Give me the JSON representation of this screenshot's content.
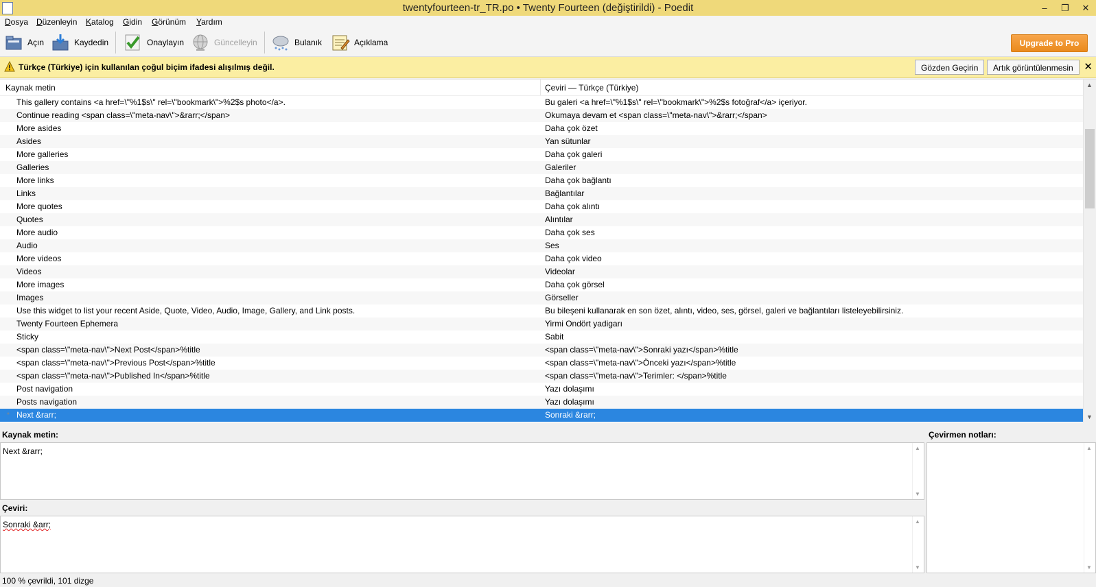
{
  "window": {
    "title": "twentyfourteen-tr_TR.po • Twenty Fourteen (değiştirildi)  - Poedit"
  },
  "menu": [
    "Dosya",
    "Düzenleyin",
    "Katalog",
    "Gidin",
    "Görünüm",
    "Yardım"
  ],
  "toolbar": {
    "open": "Açın",
    "save": "Kaydedin",
    "validate": "Onaylayın",
    "update": "Güncelleyin",
    "fuzzy": "Bulanık",
    "comment": "Açıklama",
    "upgrade": "Upgrade to Pro"
  },
  "warning": {
    "message": "Türkçe (Türkiye) için kullanılan çoğul biçim ifadesi alışılmış değil.",
    "review_button": "Gözden Geçirin",
    "dismiss_button": "Artık görüntülenmesin",
    "close": "✕"
  },
  "list": {
    "col_source": "Kaynak metin",
    "col_translation": "Çeviri — Türkçe (Türkiye)",
    "rows": [
      {
        "src": "This gallery contains <a href=\\\"%1$s\\\" rel=\\\"bookmark\\\">%2$s photo</a>.",
        "trn": "Bu galeri <a href=\\\"%1$s\\\" rel=\\\"bookmark\\\">%2$s fotoğraf</a> içeriyor."
      },
      {
        "src": "Continue reading <span class=\\\"meta-nav\\\">&rarr;</span>",
        "trn": "Okumaya devam et <span class=\\\"meta-nav\\\">&rarr;</span>"
      },
      {
        "src": "More asides",
        "trn": "Daha çok özet"
      },
      {
        "src": "Asides",
        "trn": "Yan sütunlar"
      },
      {
        "src": "More galleries",
        "trn": "Daha çok galeri"
      },
      {
        "src": "Galleries",
        "trn": "Galeriler"
      },
      {
        "src": "More links",
        "trn": "Daha çok bağlantı"
      },
      {
        "src": "Links",
        "trn": "Bağlantılar"
      },
      {
        "src": "More quotes",
        "trn": "Daha çok alıntı"
      },
      {
        "src": "Quotes",
        "trn": "Alıntılar"
      },
      {
        "src": "More audio",
        "trn": "Daha çok ses"
      },
      {
        "src": "Audio",
        "trn": "Ses"
      },
      {
        "src": "More videos",
        "trn": "Daha çok video"
      },
      {
        "src": "Videos",
        "trn": "Videolar"
      },
      {
        "src": "More images",
        "trn": "Daha çok görsel"
      },
      {
        "src": "Images",
        "trn": "Görseller"
      },
      {
        "src": "Use this widget to list your recent Aside, Quote, Video, Audio, Image, Gallery, and Link posts.",
        "trn": "Bu bileşeni kullanarak en son özet, alıntı, video, ses, görsel, galeri ve bağlantıları listeleyebilirsiniz."
      },
      {
        "src": "Twenty Fourteen Ephemera",
        "trn": "Yirmi Ondört yadigarı"
      },
      {
        "src": "Sticky",
        "trn": "Sabit"
      },
      {
        "src": "<span class=\\\"meta-nav\\\">Next Post</span>%title",
        "trn": "<span class=\\\"meta-nav\\\">Sonraki yazı</span>%title"
      },
      {
        "src": "<span class=\\\"meta-nav\\\">Previous Post</span>%title",
        "trn": "<span class=\\\"meta-nav\\\">Önceki yazı</span>%title"
      },
      {
        "src": "<span class=\\\"meta-nav\\\">Published In</span>%title",
        "trn": "<span class=\\\"meta-nav\\\">Terimler: </span>%title"
      },
      {
        "src": "Post navigation",
        "trn": "Yazı dolaşımı"
      },
      {
        "src": "Posts navigation",
        "trn": "Yazı dolaşımı"
      },
      {
        "src": "Next &rarr;",
        "trn": "Sonraki &rarr;",
        "selected": true,
        "mark": "*"
      }
    ]
  },
  "editor": {
    "source_label": "Kaynak metin:",
    "source_text": "Next &rarr;",
    "translation_label": "Çeviri:",
    "translation_text": "Sonraki &arr;",
    "notes_label": "Çevirmen notları:"
  },
  "status": "100 % çevrildi, 101 dizge"
}
